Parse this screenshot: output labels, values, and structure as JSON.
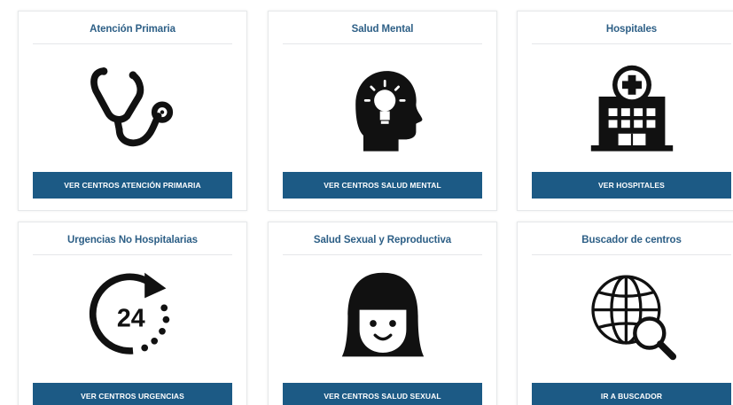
{
  "colors": {
    "title": "#2d5f86",
    "button_bg": "#1c5a85",
    "button_text": "#ffffff",
    "icon": "#111111"
  },
  "cards": [
    {
      "title": "Atención Primaria",
      "icon": "stethoscope-icon",
      "button": "VER CENTROS ATENCIÓN PRIMARIA"
    },
    {
      "title": "Salud Mental",
      "icon": "head-lightbulb-icon",
      "button": "VER CENTROS SALUD MENTAL"
    },
    {
      "title": "Hospitales",
      "icon": "hospital-icon",
      "button": "VER HOSPITALES"
    },
    {
      "title": "Urgencias No Hospitalarias",
      "icon": "24-hours-icon",
      "icon_text": "24",
      "button": "VER CENTROS URGENCIAS"
    },
    {
      "title": "Salud Sexual y Reproductiva",
      "icon": "girl-face-icon",
      "button": "VER CENTROS SALUD SEXUAL"
    },
    {
      "title": "Buscador de centros",
      "icon": "globe-search-icon",
      "button": "IR A BUSCADOR"
    }
  ]
}
